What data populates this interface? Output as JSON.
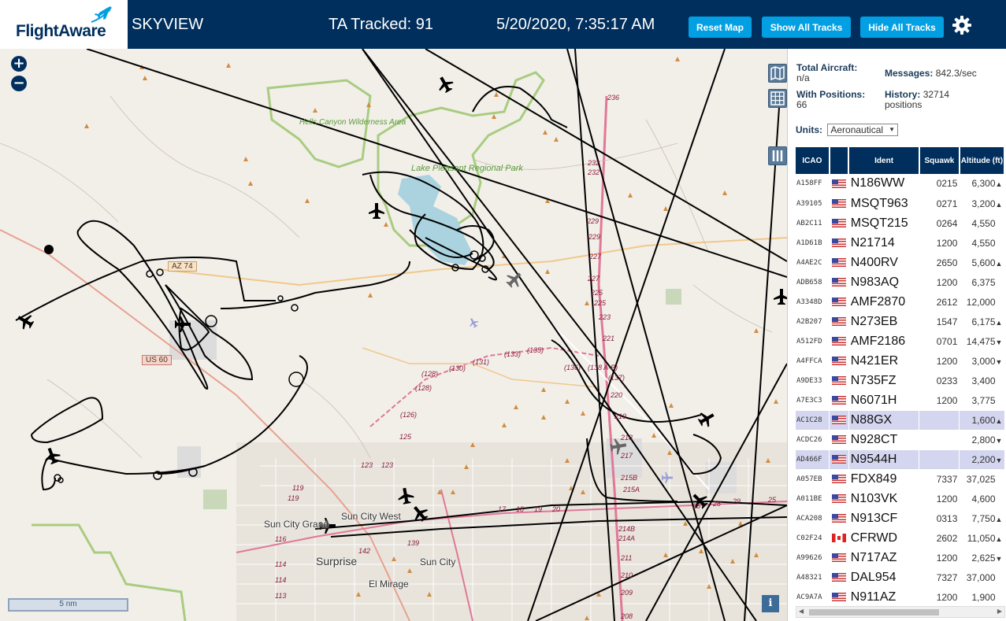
{
  "header": {
    "logo_text": "FlightAware",
    "site_name": "SKYVIEW",
    "ta_tracked": "TA Tracked: 91",
    "clock": "5/20/2020, 7:35:17 AM",
    "reset_map": "Reset Map",
    "show_all_tracks": "Show All Tracks",
    "hide_all_tracks": "Hide All Tracks",
    "settings_icon": "gear-icon"
  },
  "colors": {
    "header_bg": "#002f5d",
    "button_bg": "#02a0e3",
    "map_bg": "#f2efe9",
    "track_color": "#000000",
    "selected_row": "#d4d6f0"
  },
  "map": {
    "zoom_in": "+",
    "zoom_out": "−",
    "scale": "5 nm",
    "info": "i",
    "labels": {
      "hells_canyon": "Hells Canyon Wilderness Area",
      "lake_pleasant": "Lake Pleasant Regional Park",
      "az74": "AZ 74",
      "us60": "US 60",
      "sun_city_grand": "Sun City Grand",
      "sun_city_west": "Sun City West",
      "surprise": "Surprise",
      "sun_city": "Sun City",
      "el_mirage": "El Mirage"
    },
    "exits": [
      "236",
      "232",
      "232",
      "229",
      "229",
      "227",
      "227",
      "225",
      "225",
      "223",
      "221",
      "220",
      "219",
      "218",
      "217",
      "215B",
      "215A",
      "214B",
      "214A",
      "211",
      "210",
      "209",
      "208",
      "(135)",
      "(133)",
      "(131)",
      "(130)",
      "(128)",
      "(128)",
      "(126)",
      "125",
      "123",
      "123",
      "(136)",
      "(138 A-B)",
      "(137)",
      "119",
      "119",
      "116",
      "114",
      "114",
      "113",
      "142",
      "139",
      "17",
      "18",
      "19",
      "20",
      "26",
      "28",
      "29",
      "25"
    ]
  },
  "stats": {
    "total_aircraft_label": "Total Aircraft:",
    "total_aircraft_value": "n/a",
    "with_positions_label": "With Positions:",
    "with_positions_value": "66",
    "messages_label": "Messages:",
    "messages_value": "842.3/sec",
    "history_label": "History:",
    "history_value": "32714",
    "history_unit": "positions",
    "units_label": "Units:",
    "units_value": "Aeronautical"
  },
  "table": {
    "columns": [
      "ICAO",
      "",
      "Ident",
      "Squawk",
      "Altitude (ft)"
    ],
    "rows": [
      {
        "icao": "A158FF",
        "country": "us",
        "ident": "N186WW",
        "squawk": "0215",
        "alt": "6,300",
        "trend": "▲",
        "selected": false
      },
      {
        "icao": "A39105",
        "country": "us",
        "ident": "MSQT963",
        "squawk": "0271",
        "alt": "3,200",
        "trend": "▲",
        "selected": false
      },
      {
        "icao": "AB2C11",
        "country": "us",
        "ident": "MSQT215",
        "squawk": "0264",
        "alt": "4,550",
        "trend": "",
        "selected": false
      },
      {
        "icao": "A1D61B",
        "country": "us",
        "ident": "N21714",
        "squawk": "1200",
        "alt": "4,550",
        "trend": "",
        "selected": false
      },
      {
        "icao": "A4AE2C",
        "country": "us",
        "ident": "N400RV",
        "squawk": "2650",
        "alt": "5,600",
        "trend": "▲",
        "selected": false
      },
      {
        "icao": "ADB658",
        "country": "us",
        "ident": "N983AQ",
        "squawk": "1200",
        "alt": "6,375",
        "trend": "",
        "selected": false
      },
      {
        "icao": "A3348D",
        "country": "us",
        "ident": "AMF2870",
        "squawk": "2612",
        "alt": "12,000",
        "trend": "",
        "selected": false
      },
      {
        "icao": "A2B207",
        "country": "us",
        "ident": "N273EB",
        "squawk": "1547",
        "alt": "6,175",
        "trend": "▲",
        "selected": false
      },
      {
        "icao": "A512FD",
        "country": "us",
        "ident": "AMF2186",
        "squawk": "0701",
        "alt": "14,475",
        "trend": "▼",
        "selected": false
      },
      {
        "icao": "A4FFCA",
        "country": "us",
        "ident": "N421ER",
        "squawk": "1200",
        "alt": "3,000",
        "trend": "▼",
        "selected": false
      },
      {
        "icao": "A9DE33",
        "country": "us",
        "ident": "N735FZ",
        "squawk": "0233",
        "alt": "3,400",
        "trend": "",
        "selected": false
      },
      {
        "icao": "A7E3C3",
        "country": "us",
        "ident": "N6071H",
        "squawk": "1200",
        "alt": "3,775",
        "trend": "",
        "selected": false
      },
      {
        "icao": "AC1C28",
        "country": "us",
        "ident": "N88GX",
        "squawk": "",
        "alt": "1,600",
        "trend": "▲",
        "selected": true
      },
      {
        "icao": "ACDC26",
        "country": "us",
        "ident": "N928CT",
        "squawk": "",
        "alt": "2,800",
        "trend": "▼",
        "selected": false
      },
      {
        "icao": "AD466F",
        "country": "us",
        "ident": "N9544H",
        "squawk": "",
        "alt": "2,200",
        "trend": "▼",
        "selected": true
      },
      {
        "icao": "A057EB",
        "country": "us",
        "ident": "FDX849",
        "squawk": "7337",
        "alt": "37,025",
        "trend": "",
        "selected": false
      },
      {
        "icao": "A011BE",
        "country": "us",
        "ident": "N103VK",
        "squawk": "1200",
        "alt": "4,600",
        "trend": "",
        "selected": false
      },
      {
        "icao": "ACA208",
        "country": "us",
        "ident": "N913CF",
        "squawk": "0313",
        "alt": "7,750",
        "trend": "▲",
        "selected": false
      },
      {
        "icao": "C02F24",
        "country": "ca",
        "ident": "CFRWD",
        "squawk": "2602",
        "alt": "11,050",
        "trend": "▲",
        "selected": false
      },
      {
        "icao": "A99626",
        "country": "us",
        "ident": "N717AZ",
        "squawk": "1200",
        "alt": "2,625",
        "trend": "▼",
        "selected": false
      },
      {
        "icao": "A48321",
        "country": "us",
        "ident": "DAL954",
        "squawk": "7327",
        "alt": "37,000",
        "trend": "",
        "selected": false
      },
      {
        "icao": "AC9A7A",
        "country": "us",
        "ident": "N911AZ",
        "squawk": "1200",
        "alt": "1,900",
        "trend": "",
        "selected": false
      }
    ]
  }
}
